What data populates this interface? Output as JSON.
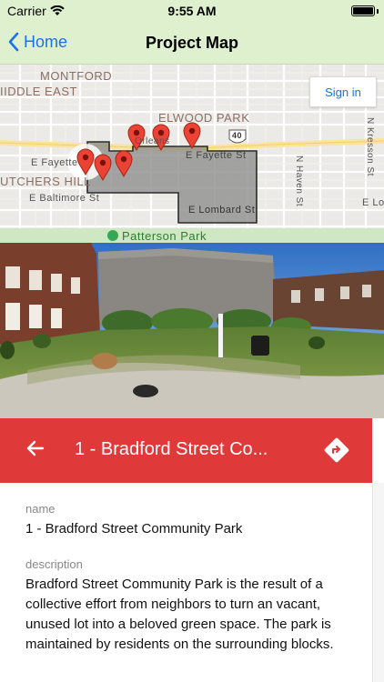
{
  "status": {
    "carrier": "Carrier",
    "time": "9:55 AM"
  },
  "nav": {
    "back_label": "Home",
    "title": "Project Map"
  },
  "map": {
    "signin_label": "Sign in",
    "labels": {
      "montford": "MONTFORD",
      "middle_east": "IIDDLE EAST",
      "elwood_park": "ELWOOD PARK",
      "butchers_hill": "UTCHERS HILL",
      "patterson_park": "Patterson Park",
      "e_fayette": "E Fayette",
      "e_fayette_st": "E Fayette St",
      "e_baltimore": "E Baltimore St",
      "e_lombard": "E Lombard St",
      "n_haven": "N Haven St",
      "n_kresson": "N Kresson St",
      "e_lo": "E Lo",
      "orleans": "Orleans",
      "route": "40"
    }
  },
  "item": {
    "title": "1 - Bradford Street Co..."
  },
  "details": {
    "name_label": "name",
    "name_value": "1 - Bradford Street Community Park",
    "description_label": "description",
    "description_value": "Bradford Street Community Park is the result of a collective effort from neighbors to turn an vacant, unused lot into a beloved green space.  The park is maintained by residents on the surrounding blocks."
  },
  "colors": {
    "bar_bg": "#dff0cf",
    "accent": "#1a73e8",
    "header_red": "#e0393a",
    "pin_red": "#ea4335"
  }
}
